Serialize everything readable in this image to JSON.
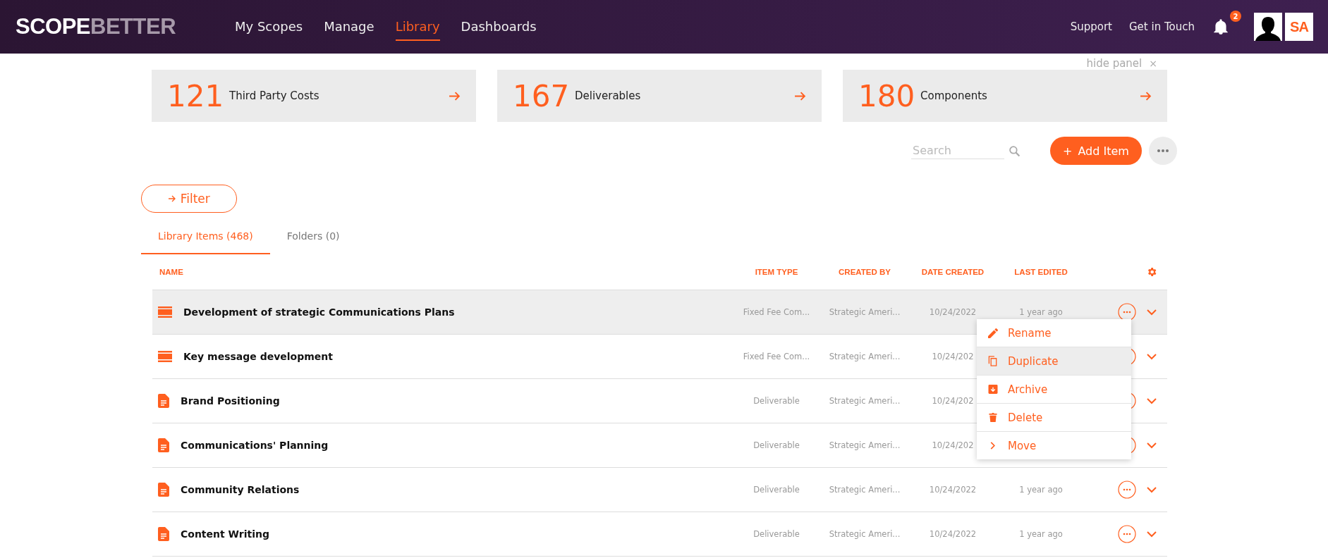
{
  "header": {
    "logo": {
      "part_1": "SCOPE",
      "part_2": "BETTER"
    },
    "nav": [
      {
        "label": "My Scopes",
        "selected": false
      },
      {
        "label": "Manage",
        "selected": false
      },
      {
        "label": "Library",
        "selected": true
      },
      {
        "label": "Dashboards",
        "selected": false
      }
    ],
    "links": [
      "Support",
      "Get in Touch"
    ],
    "notifications": {
      "count": "2"
    },
    "org_logo": {
      "text": "SA"
    }
  },
  "panel": {
    "hide_label": "hide panel",
    "close": "×",
    "stats": [
      {
        "count": "121",
        "label": "Third Party Costs"
      },
      {
        "count": "167",
        "label": "Deliverables"
      },
      {
        "count": "180",
        "label": "Components"
      }
    ]
  },
  "toolbar": {
    "search": {
      "placeholder": "Search"
    },
    "add_button": "Add Item",
    "add_icon": "+"
  },
  "filter_button": "Filter",
  "tabs": [
    {
      "label": "Library Items (468)",
      "selected": true
    },
    {
      "label": "Folders (0)",
      "selected": false
    }
  ],
  "table": {
    "columns": [
      "NAME",
      "ITEM TYPE",
      "CREATED BY",
      "DATE CREATED",
      "LAST EDITED"
    ],
    "rows": [
      {
        "kind": "component",
        "name": "Development of strategic Communications Plans",
        "item_type": "Fixed Fee Com...",
        "created_by": "Strategic Ameri...",
        "date_created": "10/24/2022",
        "last_edited": "1 year ago",
        "selected": true
      },
      {
        "kind": "component",
        "name": "Key message development",
        "item_type": "Fixed Fee Com...",
        "created_by": "Strategic Ameri...",
        "date_created": "10/24/202",
        "selected": false
      },
      {
        "kind": "deliverable",
        "name": "Brand Positioning",
        "item_type": "Deliverable",
        "created_by": "Strategic Ameri...",
        "date_created": "10/24/202",
        "selected": false
      },
      {
        "kind": "deliverable",
        "name": "Communications' Planning",
        "item_type": "Deliverable",
        "created_by": "Strategic Ameri...",
        "date_created": "10/24/202",
        "selected": false
      },
      {
        "kind": "deliverable",
        "name": "Community Relations",
        "item_type": "Deliverable",
        "created_by": "Strategic Ameri...",
        "date_created": "10/24/2022",
        "last_edited": "1 year ago",
        "selected": false
      },
      {
        "kind": "deliverable",
        "name": "Content Writing",
        "item_type": "Deliverable",
        "created_by": "Strategic Ameri...",
        "date_created": "10/24/2022",
        "last_edited": "1 year ago",
        "selected": false
      }
    ]
  },
  "context_menu": {
    "items": [
      {
        "kind": "rename",
        "label": "Rename",
        "selected": false
      },
      {
        "kind": "duplicate",
        "label": "Duplicate",
        "selected": true
      },
      {
        "kind": "archive",
        "label": "Archive",
        "selected": false
      },
      {
        "kind": "delete",
        "label": "Delete",
        "selected": false
      },
      {
        "kind": "move",
        "label": "Move",
        "selected": false
      }
    ]
  }
}
